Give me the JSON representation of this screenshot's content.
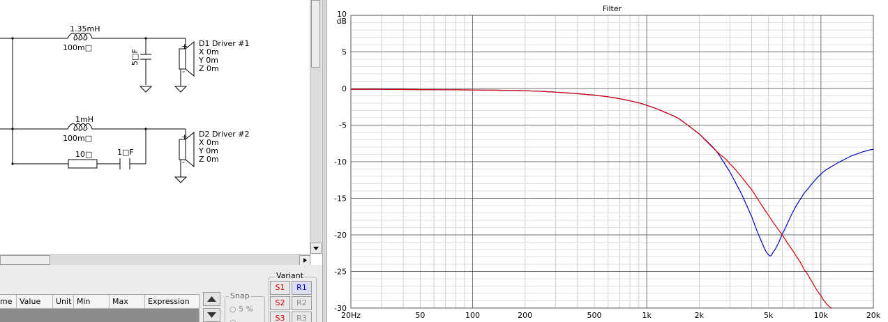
{
  "schematic": {
    "branch1": {
      "inductor_label": "1.35mH",
      "inductor_resistance": "100m□",
      "capacitor_label": "5□F",
      "driver_name": "D1 Driver #1",
      "x": "X 0m",
      "y": "Y 0m",
      "z": "Z 0m"
    },
    "branch2": {
      "inductor_label": "1mH",
      "inductor_resistance": "100m□",
      "resistor_label": "10□",
      "capacitor_label": "1□F",
      "driver_name": "D2 Driver #2",
      "x": "X 0m",
      "y": "Y 0m",
      "z": "Z 0m"
    },
    "plus": "+",
    "minus": "-"
  },
  "parameters": {
    "columns": [
      "me",
      "Value",
      "Unit",
      "Min",
      "Max",
      "Expression"
    ]
  },
  "snap": {
    "label": "Snap",
    "option1": "5 %"
  },
  "variant": {
    "label": "Variant",
    "buttons": [
      {
        "label": "S1",
        "color": "#d40000"
      },
      {
        "label": "R1",
        "color": "#0000cc"
      },
      {
        "label": "S2",
        "color": "#d40000"
      },
      {
        "label": "R2",
        "color": "#8a8a8a"
      },
      {
        "label": "S3",
        "color": "#d40000"
      },
      {
        "label": "R3",
        "color": "#8a8a8a"
      }
    ]
  },
  "chart_data": {
    "type": "line",
    "title": "Filter",
    "ylabel": "dB",
    "xscale": "log",
    "xlim": [
      20,
      20000
    ],
    "ylim": [
      -30,
      10
    ],
    "grid": true,
    "x_tick_labels": [
      {
        "v": 20,
        "t": "20Hz"
      },
      {
        "v": 50,
        "t": "50"
      },
      {
        "v": 100,
        "t": "100"
      },
      {
        "v": 200,
        "t": "200"
      },
      {
        "v": 500,
        "t": "500"
      },
      {
        "v": 1000,
        "t": "1k"
      },
      {
        "v": 2000,
        "t": "2k"
      },
      {
        "v": 5000,
        "t": "5k"
      },
      {
        "v": 10000,
        "t": "10k"
      },
      {
        "v": 20000,
        "t": "20k"
      }
    ],
    "y_ticks": [
      10,
      5,
      0,
      -5,
      -10,
      -15,
      -20,
      -25,
      -30
    ],
    "series": [
      {
        "color": "#0000cc",
        "x": [
          20,
          50,
          100,
          200,
          300,
          500,
          700,
          1000,
          1500,
          2000,
          2500,
          3000,
          3500,
          4000,
          4500,
          5000,
          5300,
          6000,
          7000,
          8000,
          10000,
          12000,
          15000,
          20000
        ],
        "y": [
          -0.1,
          -0.15,
          -0.2,
          -0.3,
          -0.5,
          -0.9,
          -1.4,
          -2.3,
          -4.0,
          -6.2,
          -8.5,
          -11.4,
          -14.4,
          -17.5,
          -20.6,
          -22.7,
          -22.4,
          -19.9,
          -16.6,
          -14.3,
          -11.7,
          -10.4,
          -9.2,
          -8.3
        ]
      },
      {
        "color": "#d40000",
        "x": [
          20,
          50,
          100,
          200,
          300,
          500,
          700,
          1000,
          1500,
          2000,
          2500,
          3000,
          4000,
          5000,
          6000,
          7000,
          8000,
          10000,
          11500
        ],
        "y": [
          -0.1,
          -0.15,
          -0.2,
          -0.3,
          -0.5,
          -0.9,
          -1.4,
          -2.3,
          -4.0,
          -6.2,
          -8.5,
          -10.3,
          -13.8,
          -17.3,
          -20.0,
          -22.4,
          -24.7,
          -28.3,
          -30
        ]
      }
    ]
  }
}
